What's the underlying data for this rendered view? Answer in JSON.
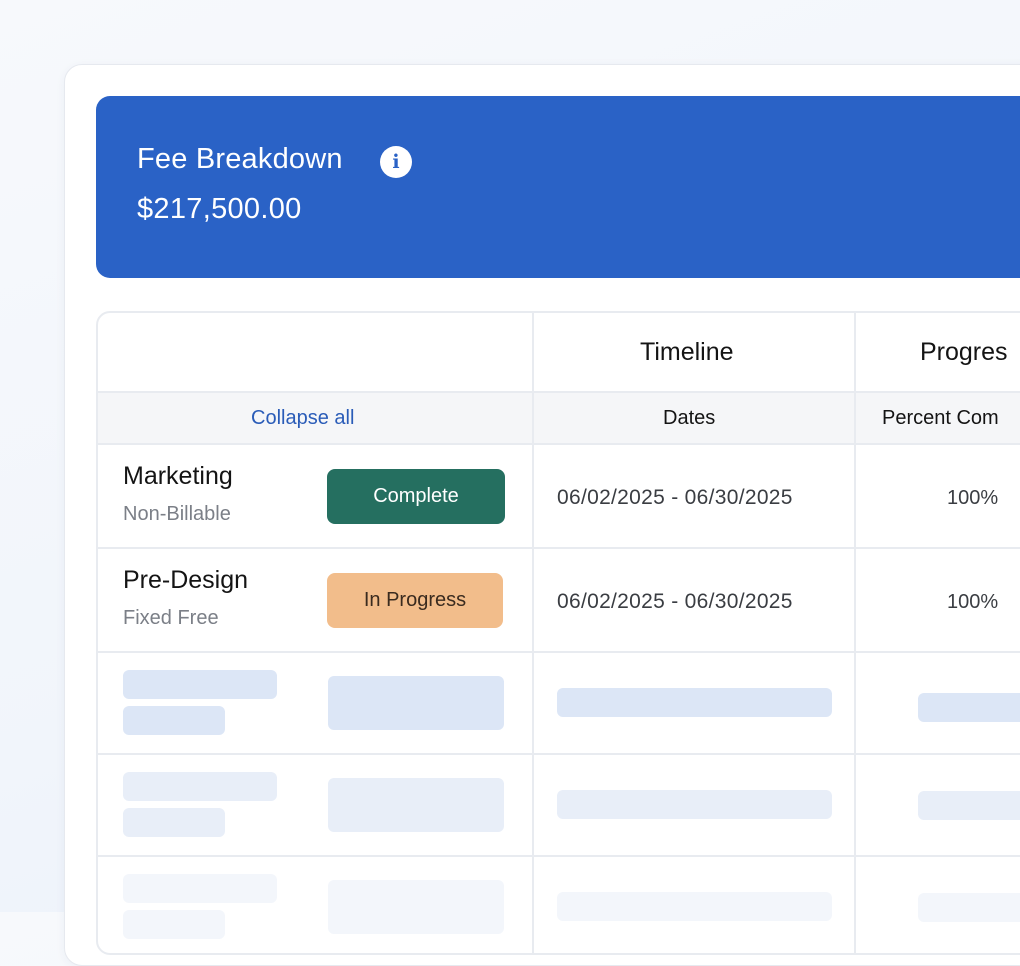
{
  "banner": {
    "title": "Fee Breakdown",
    "info_icon": "info-icon",
    "amount": "$217,500.00"
  },
  "table": {
    "headers": {
      "timeline": "Timeline",
      "progress": "Progres"
    },
    "subheaders": {
      "collapse_all": "Collapse all",
      "dates": "Dates",
      "percent_complete": "Percent Com"
    },
    "rows": [
      {
        "name": "Marketing",
        "type": "Non-Billable",
        "status": "Complete",
        "dates": "06/02/2025 - 06/30/2025",
        "percent": "100%"
      },
      {
        "name": "Pre-Design",
        "type": "Fixed Free",
        "status": "In Progress",
        "dates": "06/02/2025 - 06/30/2025",
        "percent": "100%"
      }
    ]
  },
  "colors": {
    "banner": "#2a62c6",
    "link": "#2a5cb8",
    "status_complete": "#256f60",
    "status_in_progress": "#f2bd8b",
    "skeleton": "#dce6f6"
  }
}
